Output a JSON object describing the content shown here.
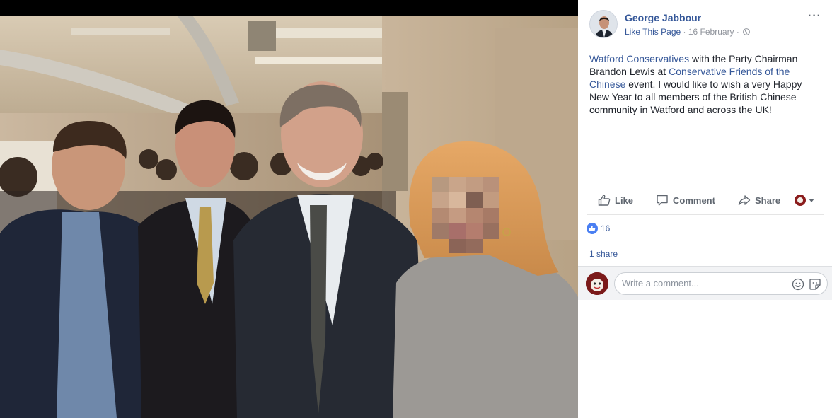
{
  "photo": {
    "description_icon": "group-photo"
  },
  "post": {
    "author": "George Jabbour",
    "like_page": "Like This Page",
    "separator_1": "·",
    "date": "16 February",
    "separator_2": "·",
    "privacy_icon": "globe-icon",
    "more_icon": "···",
    "text": {
      "link_1": "Watford Conservatives",
      "part_1": " with the Party Chairman Brandon Lewis at ",
      "link_2": "Conservative Friends of the Chinese",
      "part_2": " event. I would like to wish a very Happy New Year to all members of the British Chinese community in Watford and across the UK!"
    }
  },
  "actions": {
    "like": "Like",
    "comment": "Comment",
    "share": "Share"
  },
  "reactions": {
    "count": "16"
  },
  "shares": {
    "label": "1 share"
  },
  "comment_box": {
    "placeholder": "Write a comment..."
  },
  "colors": {
    "link": "#365899",
    "like_blue": "#4a7ff2",
    "meta_gray": "#90949c"
  }
}
